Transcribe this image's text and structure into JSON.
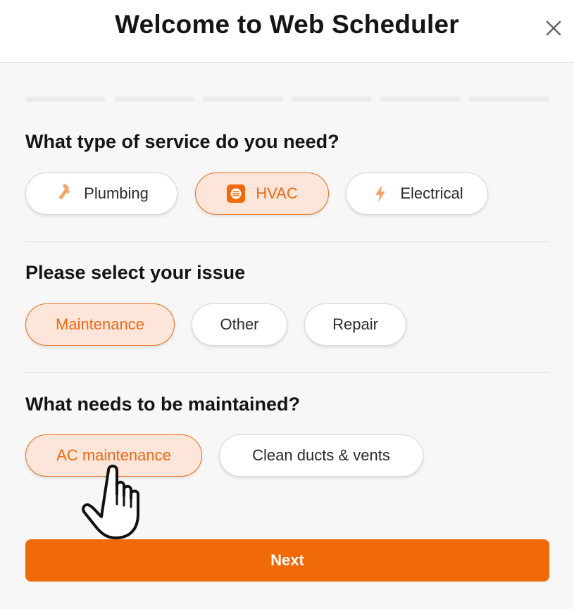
{
  "header": {
    "title": "Welcome to Web Scheduler",
    "close_icon": "close-icon"
  },
  "progress": {
    "total_steps": 6,
    "completed_steps": 0
  },
  "service": {
    "question": "What type of service do you need?",
    "options": [
      {
        "label": "Plumbing",
        "icon": "wrench-icon",
        "selected": false
      },
      {
        "label": "HVAC",
        "icon": "hvac-icon",
        "selected": true
      },
      {
        "label": "Electrical",
        "icon": "lightning-bolt-icon",
        "selected": false
      }
    ]
  },
  "issue": {
    "question": "Please select your issue",
    "options": [
      {
        "label": "Maintenance",
        "selected": true
      },
      {
        "label": "Other",
        "selected": false
      },
      {
        "label": "Repair",
        "selected": false
      }
    ]
  },
  "maintain": {
    "question": "What needs to be maintained?",
    "options": [
      {
        "label": "AC maintenance",
        "selected": true
      },
      {
        "label": "Clean ducts & vents",
        "selected": false
      }
    ]
  },
  "footer": {
    "next_label": "Next"
  },
  "colors": {
    "accent": "#f06a0a",
    "selected_bg": "#fde6d9",
    "selected_border": "#ee6f1e",
    "icon_orange": "#f4a46a"
  }
}
